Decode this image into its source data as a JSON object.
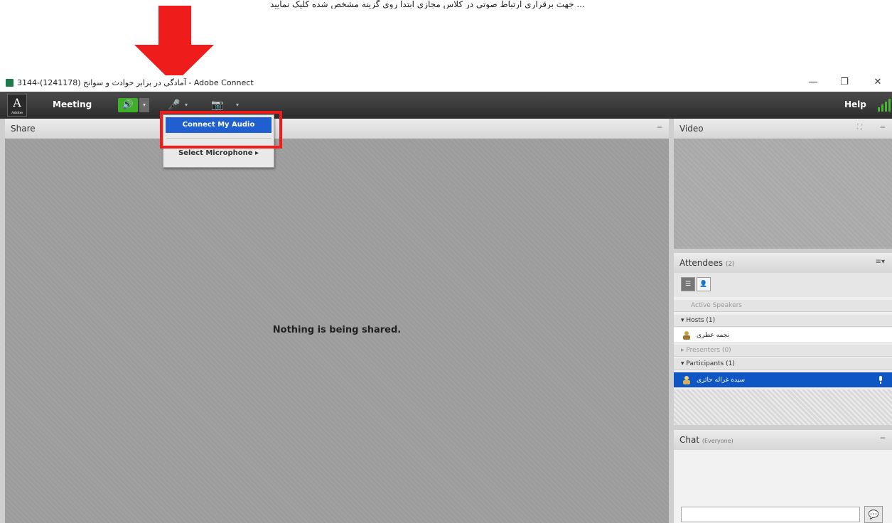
{
  "caption": "... ﻿جهت برقراری ارتباط صوتی در کلاس مجازی ابتدا روی گزینه مشخص شده کلیک نمایید",
  "window": {
    "title": "3144-(1241178) آمادگی در برابر حوادث و سوانح - Adobe Connect",
    "minimize": "—",
    "restore": "❐",
    "close": "✕"
  },
  "menubar": {
    "logo_letter": "A",
    "logo_sub": "Adobe",
    "meeting": "Meeting",
    "help": "Help",
    "speaker_icon": "🔊",
    "dropdown_icon": "▾",
    "mic_icon": "🎤",
    "camera_icon": "📷"
  },
  "dropdown": {
    "items": [
      "Connect My Audio",
      "Select Microphone  ▸"
    ]
  },
  "share": {
    "header": "Share",
    "message": "Nothing is being shared."
  },
  "video": {
    "header": "Video"
  },
  "attendees": {
    "header": "Attendees",
    "count": "(2)",
    "active_speakers": "Active Speakers",
    "hosts": "▾  Hosts (1)",
    "host_name": "نجمه عطری",
    "presenters": "▸  Presenters (0)",
    "participants": "▾  Participants (1)",
    "participant_name": "سیده غزاله حائری",
    "menu_icon": "≡▾"
  },
  "chat": {
    "header": "Chat",
    "scope": "(Everyone)",
    "send_icon": "💬"
  },
  "colors": {
    "highlight": "#ef1c1c",
    "speaker_active": "#3fae2a",
    "selected_row": "#0d56c4"
  }
}
